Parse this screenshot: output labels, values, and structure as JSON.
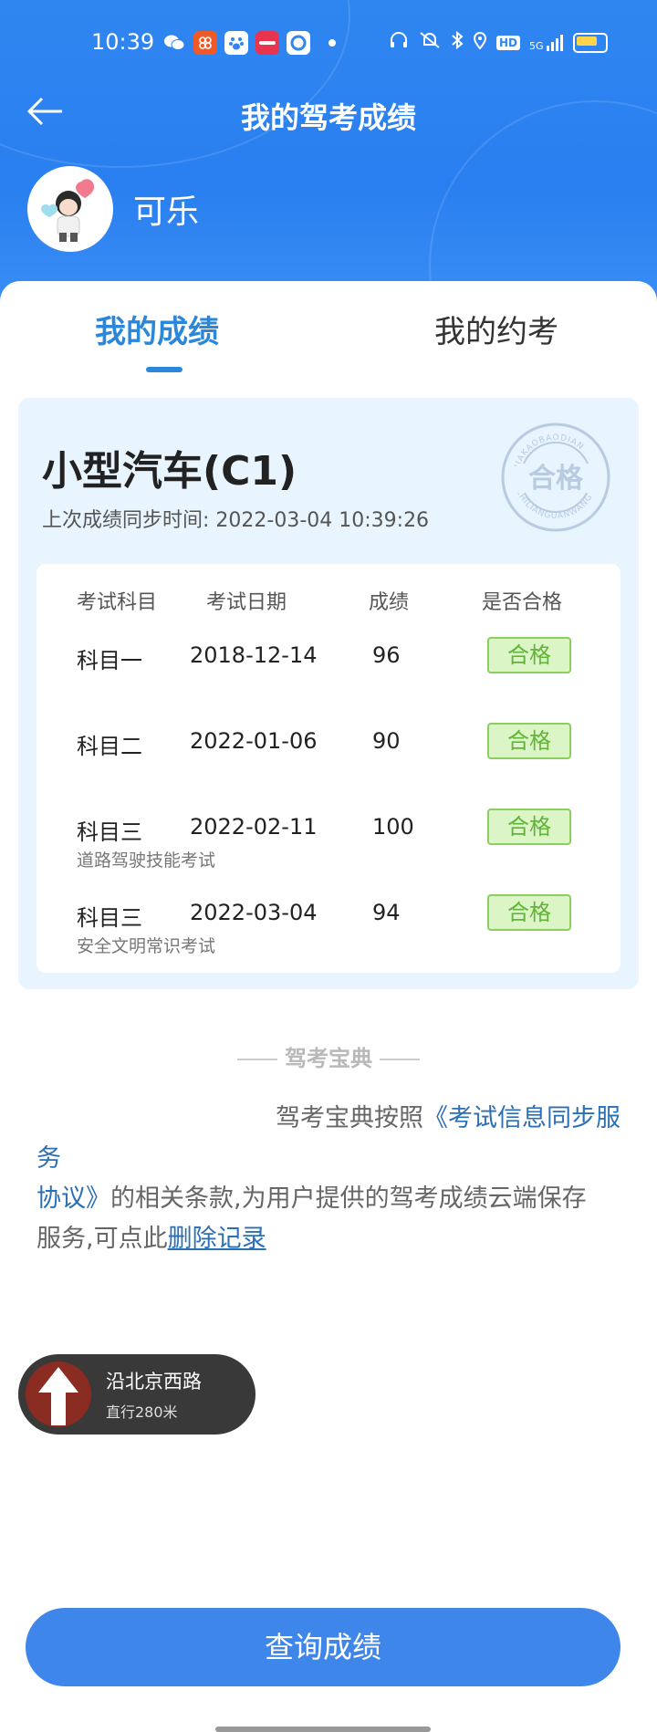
{
  "status_bar": {
    "time": "10:39",
    "network": "5G",
    "hd": "HD"
  },
  "header": {
    "title": "我的驾考成绩",
    "username": "可乐"
  },
  "tabs": [
    {
      "label": "我的成绩",
      "active": true
    },
    {
      "label": "我的约考",
      "active": false
    }
  ],
  "score_card": {
    "license_type": "小型汽车(C1)",
    "sync_label": "上次成绩同步时间: 2022-03-04 10:39:26",
    "stamp_text": "合格",
    "stamp_ring_top": "JIAKAOBAODIAN",
    "stamp_ring_bottom": "ZHILIANGUANWANG",
    "columns": [
      "考试科目",
      "考试日期",
      "成绩",
      "是否合格"
    ],
    "rows": [
      {
        "subject": "科目一",
        "date": "2018-12-14",
        "score": "96",
        "result": "合格",
        "note": ""
      },
      {
        "subject": "科目二",
        "date": "2022-01-06",
        "score": "90",
        "result": "合格",
        "note": ""
      },
      {
        "subject": "科目三",
        "date": "2022-02-11",
        "score": "100",
        "result": "合格",
        "note": "道路驾驶技能考试"
      },
      {
        "subject": "科目三",
        "date": "2022-03-04",
        "score": "94",
        "result": "合格",
        "note": "安全文明常识考试"
      }
    ]
  },
  "brand_label": "驾考宝典",
  "notice": {
    "text_a": "驾考宝典按照",
    "link_agreement_a": "《考试信息同步服务",
    "link_agreement_b": "协议》",
    "text_b": "的相关条款,为用户提供的驾考成绩云端保存",
    "text_c": "服务,可点此",
    "delete_link": "删除记录"
  },
  "navigation_overlay": {
    "road": "沿北京西路",
    "distance": "直行280米"
  },
  "query_button": "查询成绩",
  "colors": {
    "header_blue": "#2f86f0",
    "accent": "#2b87d9",
    "pass_green": "#62b438",
    "button_blue": "#3f86ea"
  }
}
